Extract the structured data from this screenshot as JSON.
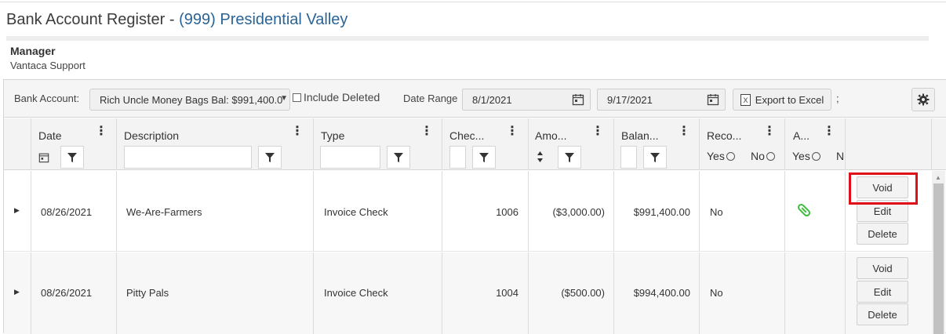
{
  "page": {
    "title_prefix": "Bank Account Register - ",
    "title_association": "(999) Presidential Valley",
    "manager_label": "Manager",
    "manager_name": "Vantaca Support"
  },
  "toolbar": {
    "bank_account_label": "Bank Account:",
    "bank_account_value": "Rich Uncle Money Bags Bal: $991,400.0",
    "include_deleted_label": "Include Deleted",
    "include_deleted_checked": false,
    "date_range_label": "Date Range",
    "date_from": "8/1/2021",
    "date_to": "9/17/2021",
    "export_label": "Export to Excel",
    "separator": ";"
  },
  "columns": {
    "date": "Date",
    "description": "Description",
    "type": "Type",
    "check": "Chec...",
    "amount": "Amo...",
    "balance": "Balan...",
    "reconciled": "Reco...",
    "attachment": "A...",
    "yes": "Yes",
    "no": "No",
    "no_truncated": "N"
  },
  "rows": [
    {
      "date": "08/26/2021",
      "description": "We-Are-Farmers",
      "type": "Invoice Check",
      "check": "1006",
      "amount": "($3,000.00)",
      "balance": "$991,400.00",
      "reconciled": "No",
      "has_attachment": true,
      "actions": [
        "Void",
        "Edit",
        "Delete"
      ]
    },
    {
      "date": "08/26/2021",
      "description": "Pitty Pals",
      "type": "Invoice Check",
      "check": "1004",
      "amount": "($500.00)",
      "balance": "$994,400.00",
      "reconciled": "No",
      "has_attachment": false,
      "actions": [
        "Void",
        "Edit",
        "Delete"
      ]
    }
  ],
  "colors": {
    "accent_link": "#2a6496",
    "highlight_box": "#e0101a",
    "attachment_icon": "#3fbf3f"
  }
}
